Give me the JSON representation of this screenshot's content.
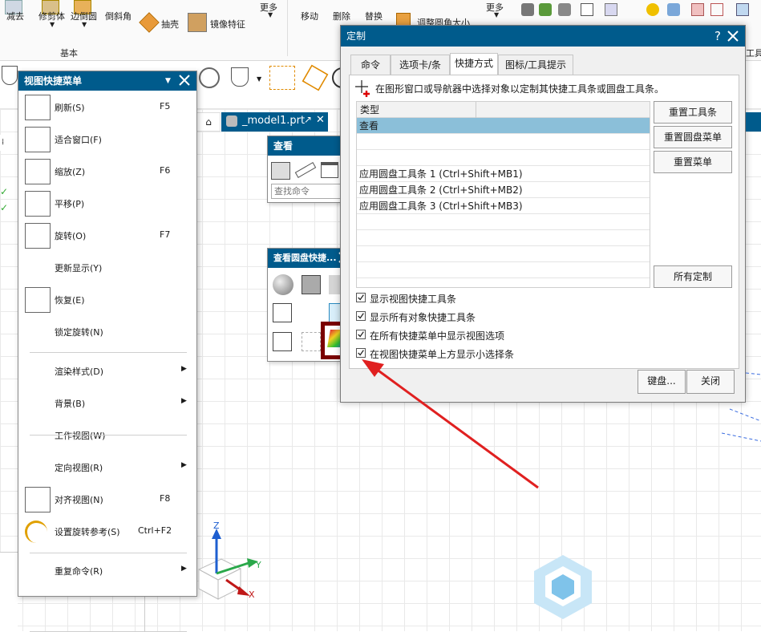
{
  "ribbon": {
    "items": [
      "减去",
      "修剪体",
      "边倒圆",
      "倒斜角",
      "抽壳",
      "镜像特征",
      "更多",
      "移动",
      "删除",
      "替换",
      "调整圆角大小",
      "更多"
    ],
    "group_label": "基本",
    "right_label": "工具"
  },
  "file_tab": {
    "label": "_model1.prt"
  },
  "view_menu": {
    "title": "视图快捷菜单",
    "items": [
      {
        "label": "刷新(S)",
        "shortcut": "F5"
      },
      {
        "label": "适合窗口(F)",
        "shortcut": ""
      },
      {
        "label": "缩放(Z)",
        "shortcut": "F6"
      },
      {
        "label": "平移(P)",
        "shortcut": ""
      },
      {
        "label": "旋转(O)",
        "shortcut": "F7"
      },
      {
        "label": "更新显示(Y)",
        "shortcut": ""
      },
      {
        "label": "恢复(E)",
        "shortcut": ""
      },
      {
        "label": "锁定旋转(N)",
        "shortcut": ""
      },
      {
        "label": "渲染样式(D)",
        "shortcut": ""
      },
      {
        "label": "背景(B)",
        "shortcut": ""
      },
      {
        "label": "工作视图(W)",
        "shortcut": ""
      },
      {
        "label": "定向视图(R)",
        "shortcut": ""
      },
      {
        "label": "对齐视图(N)",
        "shortcut": "F8"
      },
      {
        "label": "设置旋转参考(S)",
        "shortcut": "Ctrl+F2"
      },
      {
        "label": "重复命令(R)",
        "shortcut": ""
      }
    ]
  },
  "view_toolbar": {
    "title": "查看",
    "search_placeholder": "查找命令"
  },
  "radial_panel": {
    "title": "查看圆盘快捷..."
  },
  "dialog": {
    "title": "定制",
    "help": "?",
    "tabs": [
      "命令",
      "选项卡/条",
      "快捷方式",
      "图标/工具提示"
    ],
    "active_tab": 2,
    "instruction": "在图形窗口或导航器中选择对象以定制其快捷工具条或圆盘工具条。",
    "list_header": "类型",
    "list_rows": [
      "查看",
      "",
      "",
      "应用圆盘工具条 1 (Ctrl+Shift+MB1)",
      "应用圆盘工具条 2 (Ctrl+Shift+MB2)",
      "应用圆盘工具条 3 (Ctrl+Shift+MB3)",
      "",
      "",
      "",
      ""
    ],
    "selected_row": 0,
    "buttons": {
      "reset_toolbar": "重置工具条",
      "reset_radial": "重置圆盘菜单",
      "reset_menu": "重置菜单",
      "all_custom": "所有定制",
      "keyboard": "键盘...",
      "close": "关闭"
    },
    "checkboxes": [
      {
        "label": "显示视图快捷工具条",
        "checked": true
      },
      {
        "label": "显示所有对象快捷工具条",
        "checked": true
      },
      {
        "label": "在所有快捷菜单中显示视图选项",
        "checked": true
      },
      {
        "label": "在视图快捷菜单上方显示小选择条",
        "checked": true
      }
    ]
  },
  "axes": {
    "x": "X",
    "y": "Y",
    "z": "Z"
  },
  "colors": {
    "title_blue": "#005b8c",
    "highlight": "#8bbfd9",
    "annotation_red": "#e02020",
    "box_dark_red": "#7a0000"
  }
}
